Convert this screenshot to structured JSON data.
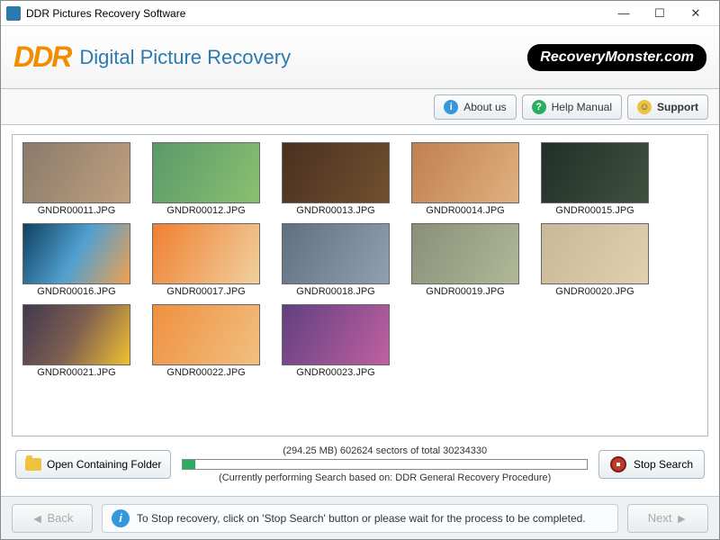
{
  "window": {
    "title": "DDR Pictures Recovery Software"
  },
  "header": {
    "logo": "DDR",
    "title": "Digital Picture Recovery",
    "brand": "RecoveryMonster.com"
  },
  "toolbar": {
    "about": "About us",
    "help": "Help Manual",
    "support": "Support"
  },
  "files": [
    {
      "name": "GNDR00011.JPG"
    },
    {
      "name": "GNDR00012.JPG"
    },
    {
      "name": "GNDR00013.JPG"
    },
    {
      "name": "GNDR00014.JPG"
    },
    {
      "name": "GNDR00015.JPG"
    },
    {
      "name": "GNDR00016.JPG"
    },
    {
      "name": "GNDR00017.JPG"
    },
    {
      "name": "GNDR00018.JPG"
    },
    {
      "name": "GNDR00019.JPG"
    },
    {
      "name": "GNDR00020.JPG"
    },
    {
      "name": "GNDR00021.JPG"
    },
    {
      "name": "GNDR00022.JPG"
    },
    {
      "name": "GNDR00023.JPG"
    }
  ],
  "progress": {
    "open_folder": "Open Containing Folder",
    "sectors": "(294.25 MB) 602624  sectors  of  total 30234330",
    "procedure": "(Currently performing Search based on:  DDR General Recovery Procedure)",
    "stop": "Stop Search"
  },
  "footer": {
    "back": "Back",
    "next": "Next",
    "message": "To Stop recovery, click on 'Stop Search' button or please wait for the process to be completed."
  }
}
